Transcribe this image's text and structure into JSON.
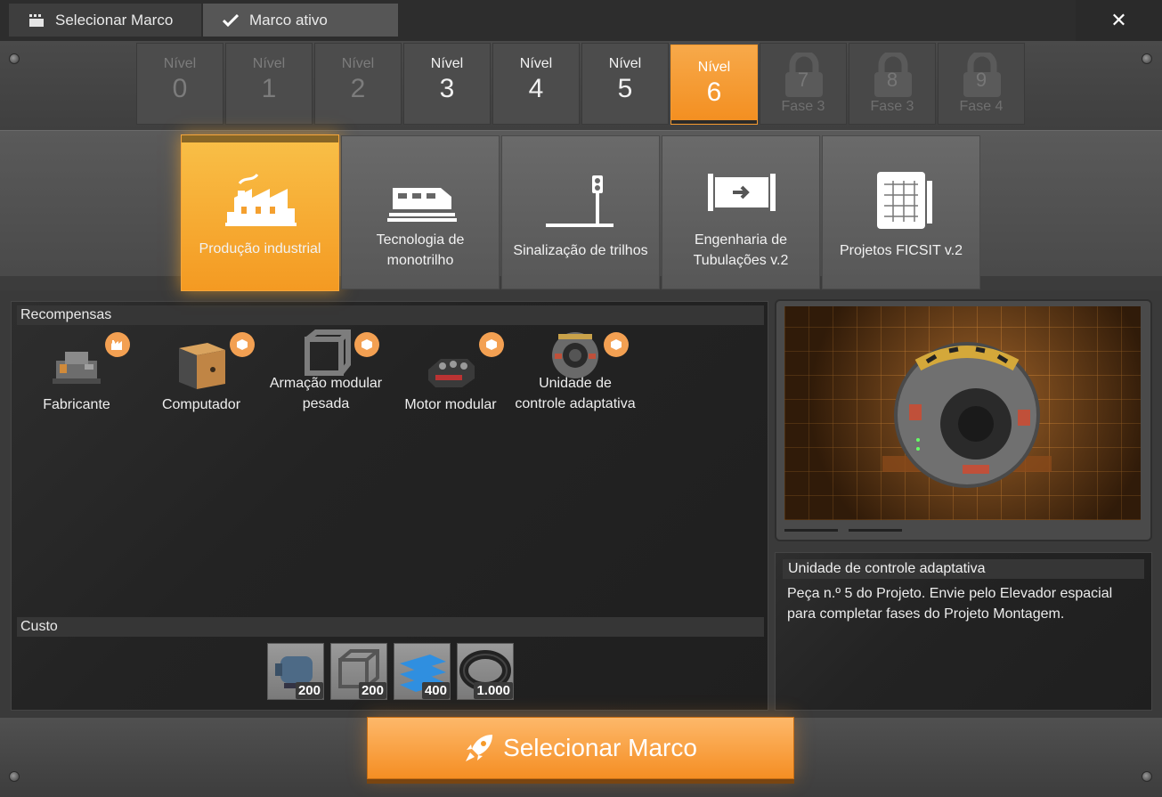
{
  "tabs": [
    {
      "label": "Selecionar Marco",
      "icon": "grid-icon"
    },
    {
      "label": "Marco ativo",
      "icon": "checkmark-icon"
    }
  ],
  "close_label": "✕",
  "tiers": [
    {
      "label": "Nível",
      "number": "0",
      "state": "dim"
    },
    {
      "label": "Nível",
      "number": "1",
      "state": "dim"
    },
    {
      "label": "Nível",
      "number": "2",
      "state": "dim"
    },
    {
      "label": "Nível",
      "number": "3",
      "state": "on"
    },
    {
      "label": "Nível",
      "number": "4",
      "state": "on"
    },
    {
      "label": "Nível",
      "number": "5",
      "state": "on"
    },
    {
      "label": "Nível",
      "number": "6",
      "state": "active"
    },
    {
      "number": "7",
      "phase": "Fase 3",
      "state": "locked"
    },
    {
      "number": "8",
      "phase": "Fase 3",
      "state": "locked"
    },
    {
      "number": "9",
      "phase": "Fase 4",
      "state": "locked"
    }
  ],
  "schematics": [
    {
      "label": "Produção industrial",
      "icon": "factory-icon",
      "active": true
    },
    {
      "label": "Tecnologia de monotrilho",
      "icon": "train-icon",
      "active": false
    },
    {
      "label": "Sinalização de trilhos",
      "icon": "railway-signal-icon",
      "active": false
    },
    {
      "label": "Engenharia de Tubulações v.2",
      "icon": "pipeline-icon",
      "active": false
    },
    {
      "label": "Projetos FICSIT v.2",
      "icon": "blueprint-icon",
      "active": false
    }
  ],
  "rewards_header": "Recompensas",
  "rewards": [
    {
      "name": "Fabricante",
      "badge": "factory-badge-icon"
    },
    {
      "name": "Computador",
      "badge": "cube-badge-icon"
    },
    {
      "name": "Armação modular pesada",
      "badge": "cube-badge-icon"
    },
    {
      "name": "Motor modular",
      "badge": "cube-badge-icon"
    },
    {
      "name": "Unidade de controle adaptativa",
      "badge": "cube-badge-icon"
    }
  ],
  "cost_header": "Custo",
  "cost_items": [
    {
      "item": "motor-icon",
      "qty": "200"
    },
    {
      "item": "frame-icon",
      "qty": "200"
    },
    {
      "item": "plates-icon",
      "qty": "400"
    },
    {
      "item": "cable-coil-icon",
      "qty": "1.000"
    }
  ],
  "preview": {
    "title": "Unidade de controle adaptativa",
    "description": "Peça n.º 5 do Projeto. Envie pelo Elevador espacial para completar fases do Projeto Montagem."
  },
  "select_button": {
    "label": "Selecionar Marco",
    "icon": "rocket-icon"
  },
  "colors": {
    "accent": "#f59a2a",
    "panel": "#232323",
    "frame": "#4a4a4a"
  }
}
